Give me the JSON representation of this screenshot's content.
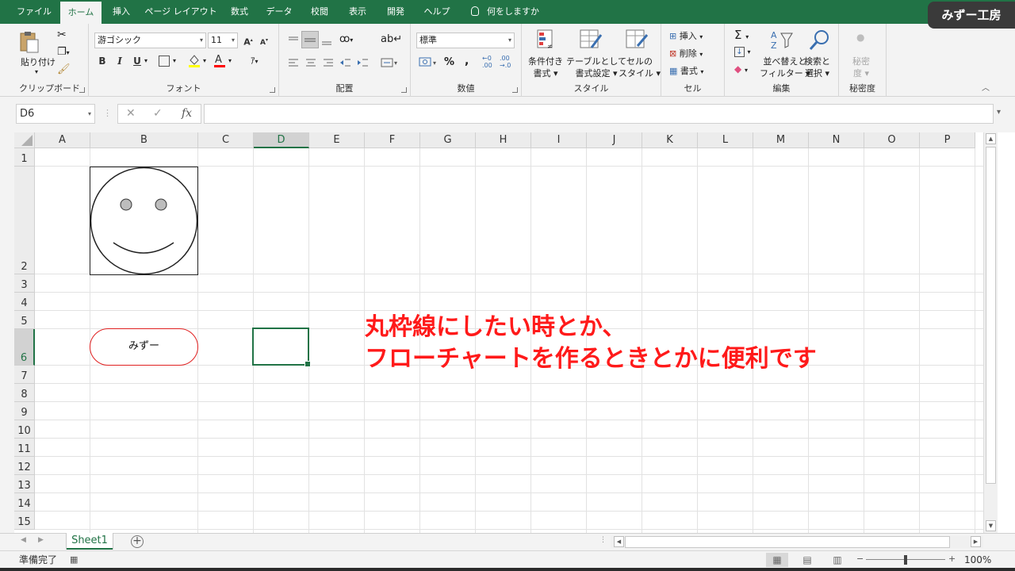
{
  "brand": "みずー工房",
  "tabs": [
    {
      "label": "ファイル",
      "active": false
    },
    {
      "label": "ホーム",
      "active": true
    },
    {
      "label": "挿入",
      "active": false
    },
    {
      "label": "ページ レイアウト",
      "active": false
    },
    {
      "label": "数式",
      "active": false
    },
    {
      "label": "データ",
      "active": false
    },
    {
      "label": "校閲",
      "active": false
    },
    {
      "label": "表示",
      "active": false
    },
    {
      "label": "開発",
      "active": false
    },
    {
      "label": "ヘルプ",
      "active": false
    }
  ],
  "tell_me": "何をしますか",
  "ribbon": {
    "clipboard": {
      "label": "クリップボード",
      "paste": "貼り付け"
    },
    "font": {
      "label": "フォント",
      "font_name": "游ゴシック",
      "font_size": "11",
      "bold": "B",
      "italic": "I",
      "underline": "U"
    },
    "alignment": {
      "label": "配置"
    },
    "number": {
      "label": "数値",
      "format": "標準",
      "percent": "%",
      "comma": ","
    },
    "styles": {
      "label": "スタイル",
      "conditional": [
        "条件付き",
        "書式"
      ],
      "table": [
        "テーブルとして",
        "書式設定"
      ],
      "cell_styles": [
        "セルの",
        "スタイル"
      ]
    },
    "cells": {
      "label": "セル",
      "insert": "挿入",
      "delete": "削除",
      "format": "書式"
    },
    "editing": {
      "label": "編集",
      "sort": [
        "並べ替えと",
        "フィルター"
      ],
      "find": [
        "検索と",
        "選択"
      ]
    },
    "sensitivity": {
      "label": "秘密度",
      "button": [
        "秘密",
        "度"
      ]
    }
  },
  "formula_bar": {
    "name_box": "D6",
    "fx": "fx",
    "cancel": "✕",
    "enter": "✓",
    "value": ""
  },
  "columns": [
    "A",
    "B",
    "C",
    "D",
    "E",
    "F",
    "G",
    "H",
    "I",
    "J",
    "K",
    "L",
    "M",
    "N",
    "O",
    "P"
  ],
  "rows": [
    "1",
    "2",
    "3",
    "4",
    "5",
    "6",
    "7",
    "8",
    "9",
    "10",
    "11",
    "12",
    "13",
    "14",
    "15"
  ],
  "selected_cell": {
    "column": "D",
    "row": "6"
  },
  "shapes": {
    "pill_text": "みずー"
  },
  "annotation": {
    "line1": "丸枠線にしたい時とか、",
    "line2": "フローチャートを作るときとかに便利です",
    "color": "#ff1a1a"
  },
  "sheets": [
    {
      "name": "Sheet1",
      "active": true
    }
  ],
  "status": {
    "ready": "準備完了",
    "zoom": "100%"
  },
  "colors": {
    "excel_green": "#217346",
    "shape_red": "#e02020"
  }
}
